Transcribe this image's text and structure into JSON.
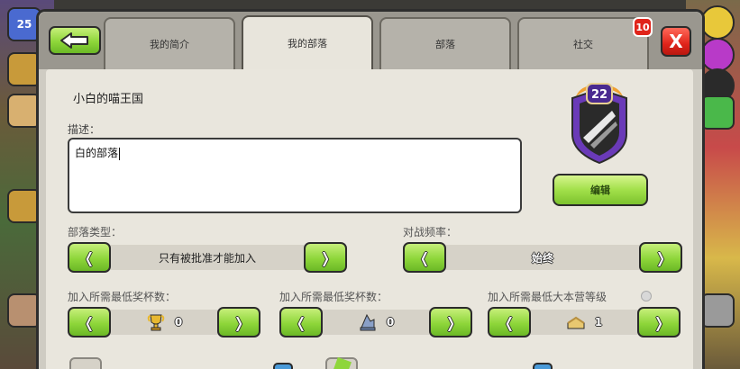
{
  "header": {
    "tabs": [
      {
        "label": "我的简介",
        "active": false
      },
      {
        "label": "我的部落",
        "active": true
      },
      {
        "label": "部落",
        "active": false
      },
      {
        "label": "社交",
        "active": false
      }
    ],
    "notification_count": "10",
    "close_label": "X"
  },
  "clan": {
    "name": "小白的喵王国",
    "badge_level": "22",
    "description_label": "描述：",
    "description_value": "白的部落",
    "edit_label": "编辑"
  },
  "settings": {
    "clan_type_label": "部落类型：",
    "clan_type_value": "只有被批准才能加入",
    "war_frequency_label": "对战频率：",
    "war_frequency_value": "始终",
    "min_trophies_label": "加入所需最低奖杯数：",
    "min_trophies_value": "0",
    "min_builder_trophies_label": "加入所需最低奖杯数：",
    "min_builder_trophies_value": "0",
    "min_townhall_label": "加入所需最低大本营等级",
    "min_townhall_value": "1"
  },
  "side": {
    "player_level": "25"
  },
  "colors": {
    "green_button": "#8ed63a",
    "red_button": "#e0241a",
    "panel": "#e9e6dd"
  }
}
